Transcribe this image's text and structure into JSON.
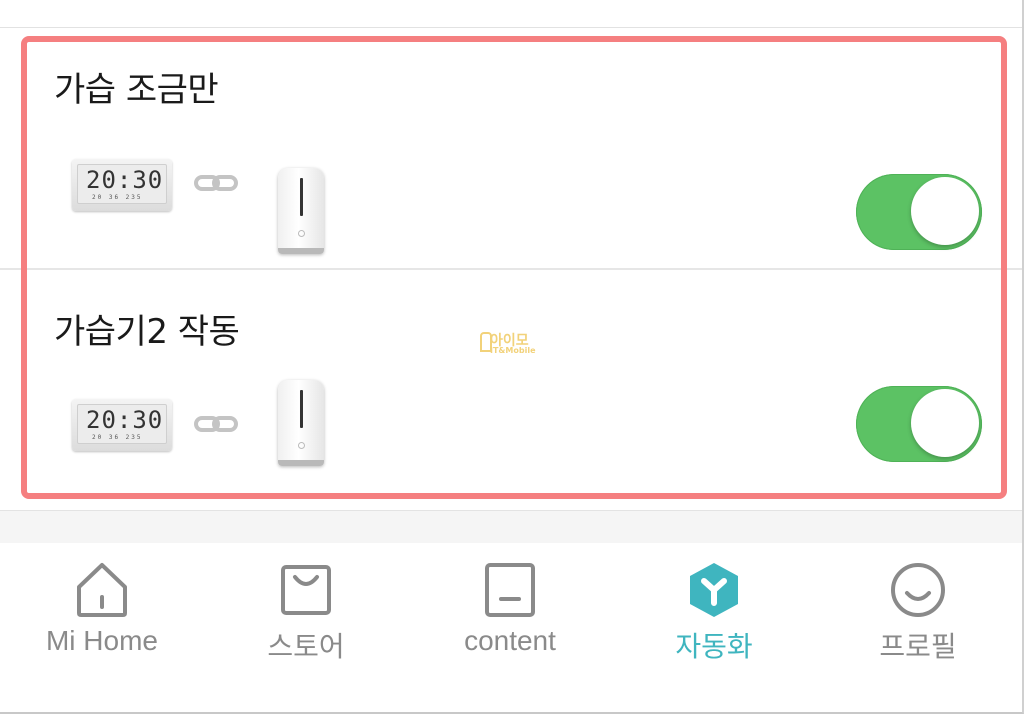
{
  "automations": [
    {
      "title": "가습 조금만",
      "clock": {
        "time": "20:30",
        "sub": "20 36 235"
      },
      "enabled": true
    },
    {
      "title": "가습기2 작동",
      "clock": {
        "time": "20:30",
        "sub": "20 36 235"
      },
      "enabled": true
    }
  ],
  "watermark": {
    "main": "아이모",
    "sub": "IT&Mobile"
  },
  "tabbar": {
    "active": "automation",
    "tabs": [
      {
        "label": "Mi Home",
        "icon": "home-icon"
      },
      {
        "label": "스토어",
        "icon": "bag-icon"
      },
      {
        "label": "content",
        "icon": "tablet-icon"
      },
      {
        "label": "자동화",
        "icon": "automation-hex-icon"
      },
      {
        "label": "프로필",
        "icon": "smiley-icon"
      }
    ]
  },
  "colors": {
    "toggle_on": "#5cc264",
    "active_tab": "#3fb5bf",
    "highlight_border": "#f57f80",
    "inactive_tab": "#8a8a8a"
  }
}
